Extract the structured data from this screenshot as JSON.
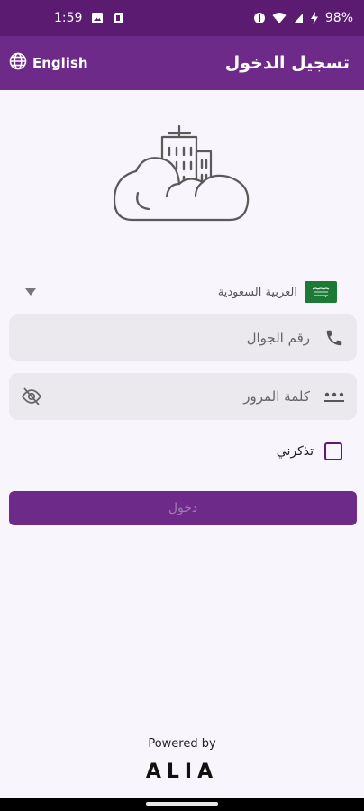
{
  "status_bar": {
    "time": "1:59",
    "battery": "98%",
    "icons": [
      "image-icon",
      "sd-card-icon",
      "do-not-disturb-icon",
      "wifi-icon",
      "signal-icon",
      "battery-charging-icon"
    ]
  },
  "app_bar": {
    "title": "تسجيل الدخول",
    "language_toggle": "English",
    "language_icon": "globe-icon"
  },
  "country": {
    "name": "العربية السعودية",
    "flag": "saudi-arabia-flag"
  },
  "phone_field": {
    "placeholder": "رقم الجوال",
    "icon": "phone-icon"
  },
  "password_field": {
    "placeholder": "كلمة المرور",
    "icon": "password-dots-icon",
    "toggle_icon": "visibility-off-icon"
  },
  "remember_me": {
    "label": "تذكرني",
    "checked": false
  },
  "login_button": {
    "label": "دخول"
  },
  "footer": {
    "powered_by": "Powered by",
    "brand": "ALIA"
  },
  "colors": {
    "status_bar": "#5a1b70",
    "app_bar": "#6e2a88",
    "field_background": "#ebe8ee",
    "page_background": "#f8f6fc"
  }
}
